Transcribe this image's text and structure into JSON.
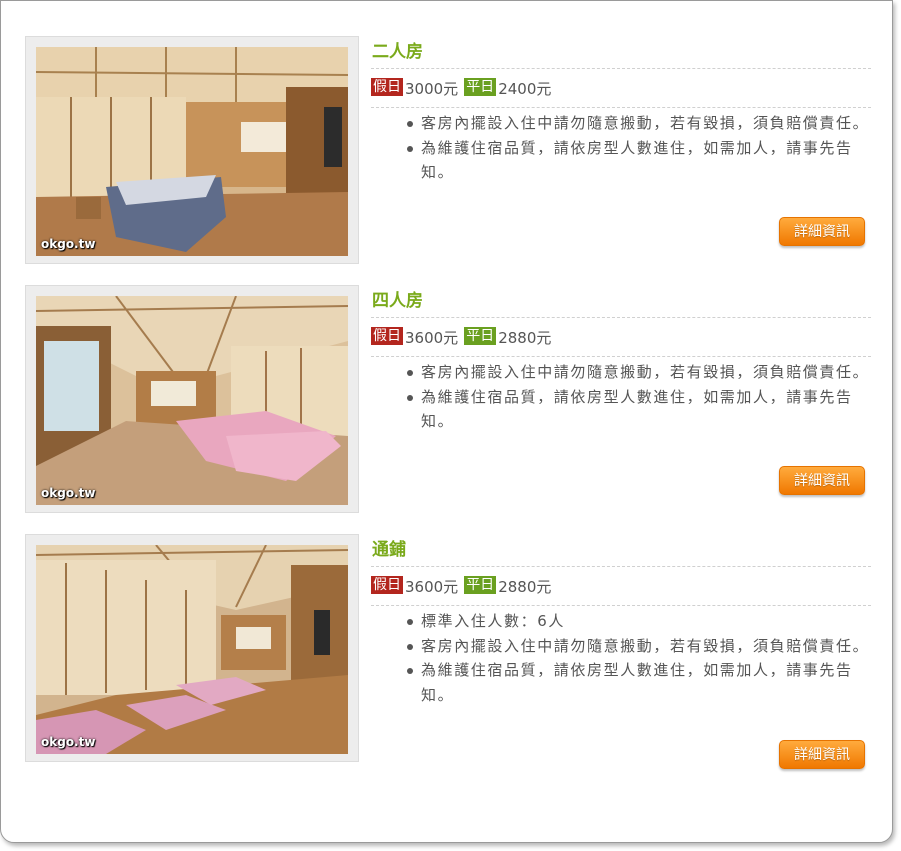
{
  "labels": {
    "holiday": "假日",
    "weekday": "平日",
    "detail_button": "詳細資訊"
  },
  "watermark": "okgo.tw",
  "rooms": [
    {
      "name": "二人房",
      "holiday_price": "3000元",
      "weekday_price": "2400元",
      "notes": [
        "客房內擺設入住中請勿隨意搬動，若有毀損，須負賠償責任。",
        "為維護住宿品質，請依房型人數進住，如需加人，請事先告知。"
      ]
    },
    {
      "name": "四人房",
      "holiday_price": "3600元",
      "weekday_price": "2880元",
      "notes": [
        "客房內擺設入住中請勿隨意搬動，若有毀損，須負賠償責任。",
        "為維護住宿品質，請依房型人數進住，如需加人，請事先告知。"
      ]
    },
    {
      "name": "通鋪",
      "holiday_price": "3600元",
      "weekday_price": "2880元",
      "notes": [
        "標準入住人數：6人",
        "客房內擺設入住中請勿隨意搬動，若有毀損，須負賠償責任。",
        "為維護住宿品質，請依房型人數進住，如需加人，請事先告知。"
      ]
    }
  ],
  "colors": {
    "title_green": "#7aaa1b",
    "holiday_red": "#b3261e",
    "weekday_green": "#6aa020",
    "button_orange": "#f58a0f"
  }
}
